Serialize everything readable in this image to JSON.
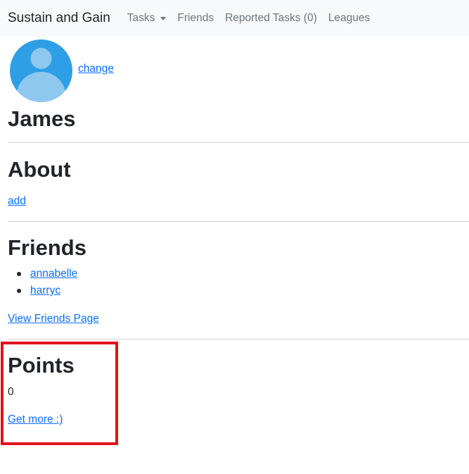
{
  "navbar": {
    "brand": "Sustain and Gain",
    "items": [
      {
        "label": "Tasks",
        "has_dropdown": true
      },
      {
        "label": "Friends",
        "has_dropdown": false
      },
      {
        "label": "Reported Tasks (0)",
        "has_dropdown": false
      },
      {
        "label": "Leagues",
        "has_dropdown": false
      }
    ]
  },
  "profile": {
    "avatar_icon": "user-avatar-icon",
    "change_label": "change",
    "name": "James"
  },
  "about": {
    "title": "About",
    "add_label": "add"
  },
  "friends": {
    "title": "Friends",
    "list": [
      "annabelle",
      "harryc"
    ],
    "view_label": "View Friends Page"
  },
  "points": {
    "title": "Points",
    "value": "0",
    "get_more_label": "Get more :)"
  },
  "colors": {
    "link": "#0d6efd",
    "navbar_bg": "#f8f9fa",
    "highlight_border": "#e0131e",
    "avatar_bg": "#2e9fe6",
    "avatar_figure": "#8ec8ef"
  }
}
